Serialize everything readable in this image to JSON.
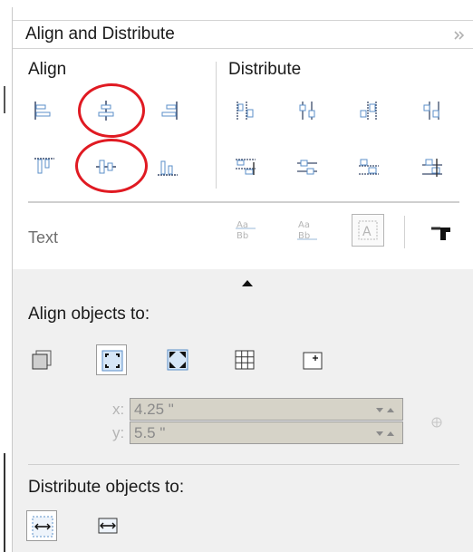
{
  "panel": {
    "title": "Align and Distribute"
  },
  "align": {
    "label": "Align",
    "buttons": [
      "align-left-icon",
      "align-center-horizontal-icon",
      "align-right-icon",
      "align-top-icon",
      "align-center-vertical-icon",
      "align-bottom-icon"
    ]
  },
  "distribute": {
    "label": "Distribute",
    "buttons": [
      "distribute-left-icon",
      "distribute-center-horizontal-icon",
      "distribute-spacing-horizontal-icon",
      "distribute-right-icon",
      "distribute-top-icon",
      "distribute-center-vertical-icon",
      "distribute-spacing-vertical-icon",
      "distribute-bottom-icon"
    ]
  },
  "text": {
    "label": "Text",
    "buttons": [
      "text-first-baseline-icon",
      "text-last-baseline-icon",
      "text-bounding-box-icon",
      "outline-icon"
    ]
  },
  "align_objects_to": {
    "label": "Align objects to:",
    "buttons": [
      "active-objects-icon",
      "page-edge-icon",
      "page-center-icon",
      "grid-icon",
      "specified-point-icon"
    ],
    "selected": "page-edge-icon"
  },
  "coords": {
    "x_label": "x:",
    "x_value": "4.25 \"",
    "y_label": "y:",
    "y_value": "5.5 \""
  },
  "distribute_objects_to": {
    "label": "Distribute objects to:",
    "buttons": [
      "selection-extent-icon",
      "page-extent-icon"
    ]
  },
  "annotations": {
    "ring_color": "#e01a22"
  }
}
